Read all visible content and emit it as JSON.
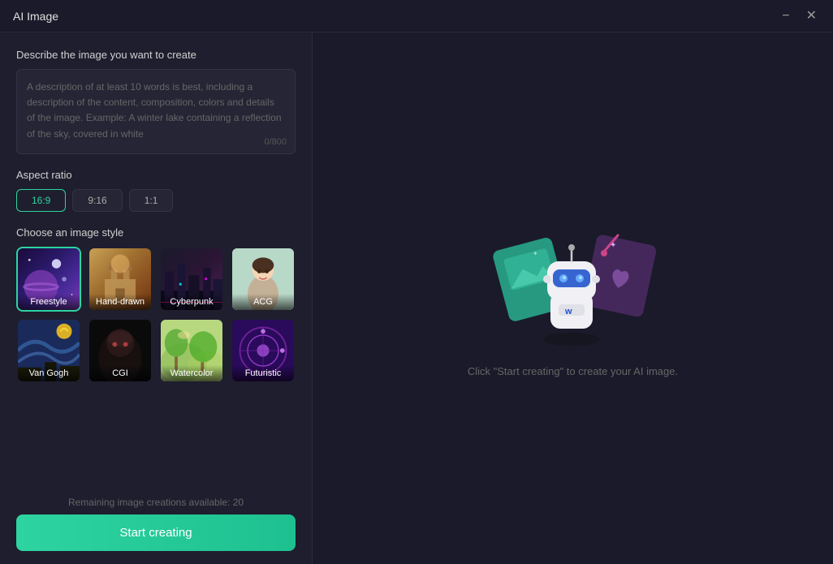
{
  "titleBar": {
    "title": "AI Image",
    "minimizeLabel": "−",
    "closeLabel": "✕"
  },
  "leftPanel": {
    "descriptionSection": {
      "label": "Describe the image you want to create",
      "placeholder": "A description of at least 10 words is best, including a description of the content, composition, colors and details of the image. Example: A winter lake containing a reflection of the sky, covered in white",
      "charCount": "0/800"
    },
    "aspectRatioSection": {
      "label": "Aspect ratio",
      "options": [
        {
          "id": "16-9",
          "label": "16:9",
          "active": true
        },
        {
          "id": "9-16",
          "label": "9:16",
          "active": false
        },
        {
          "id": "1-1",
          "label": "1:1",
          "active": false
        }
      ]
    },
    "styleSection": {
      "label": "Choose an image style",
      "styles": [
        {
          "id": "freestyle",
          "label": "Freestyle",
          "active": true
        },
        {
          "id": "hand-drawn",
          "label": "Hand-drawn",
          "active": false
        },
        {
          "id": "cyberpunk",
          "label": "Cyberpunk",
          "active": false
        },
        {
          "id": "acg",
          "label": "ACG",
          "active": false
        },
        {
          "id": "van-gogh",
          "label": "Van Gogh",
          "active": false
        },
        {
          "id": "cgi",
          "label": "CGI",
          "active": false
        },
        {
          "id": "watercolor",
          "label": "Watercolor",
          "active": false
        },
        {
          "id": "futuristic",
          "label": "Futuristic",
          "active": false
        }
      ]
    },
    "bottomSection": {
      "remainingText": "Remaining image creations available: 20",
      "startBtnLabel": "Start creating"
    }
  },
  "rightPanel": {
    "hintText": "Click \"Start creating\" to create your AI image."
  },
  "colors": {
    "accent": "#2dd4a0",
    "background": "#1e1e2e",
    "panelBg": "#1a1a2a"
  }
}
